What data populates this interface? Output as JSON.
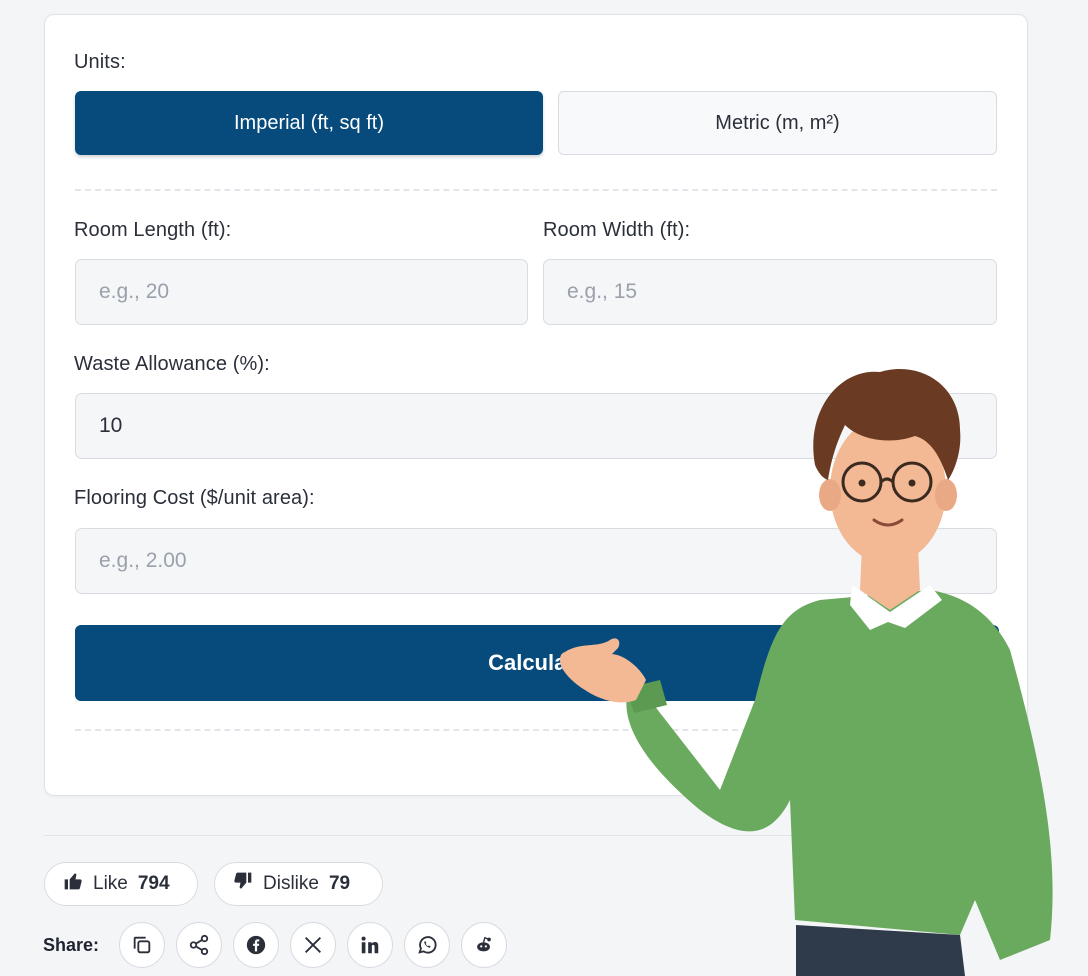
{
  "form": {
    "units_label": "Units:",
    "unit_imperial": "Imperial (ft, sq ft)",
    "unit_metric": "Metric (m, m²)",
    "length_label": "Room Length (ft):",
    "length_placeholder": "e.g., 20",
    "width_label": "Room Width (ft):",
    "width_placeholder": "e.g., 15",
    "waste_label": "Waste Allowance (%):",
    "waste_value": "10",
    "cost_label": "Flooring Cost ($/unit area):",
    "cost_placeholder": "e.g., 2.00",
    "calculate_label": "Calculate"
  },
  "feedback": {
    "like_label": "Like",
    "like_count": "794",
    "dislike_label": "Dislike",
    "dislike_count": "79"
  },
  "share": {
    "label": "Share:",
    "icons": [
      "copy-icon",
      "share-icon",
      "facebook-icon",
      "x-icon",
      "linkedin-icon",
      "whatsapp-icon",
      "reddit-icon"
    ]
  },
  "colors": {
    "primary": "#074a7c",
    "sweater": "#6aaa5e",
    "hair": "#6b3a22"
  }
}
